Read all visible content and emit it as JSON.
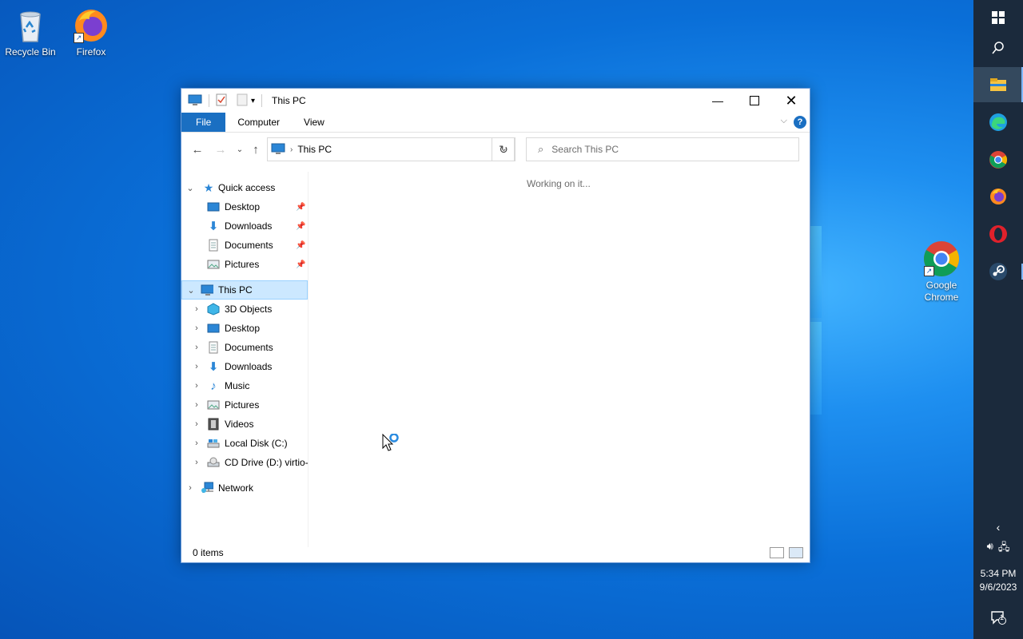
{
  "desktop": {
    "icons": [
      {
        "label": "Recycle Bin",
        "icon": "recycle-bin-icon"
      },
      {
        "label": "Firefox",
        "icon": "firefox-icon"
      },
      {
        "label": "Google Chrome",
        "icon": "chrome-icon"
      }
    ]
  },
  "window": {
    "title": "This PC",
    "ribbon_tabs": [
      "File",
      "Computer",
      "View"
    ],
    "address": {
      "crumb": "This PC"
    },
    "search": {
      "placeholder": "Search This PC"
    },
    "content_message": "Working on it...",
    "status": "0 items",
    "nav": {
      "quick_access": {
        "label": "Quick access",
        "items": [
          {
            "label": "Desktop",
            "pinned": true
          },
          {
            "label": "Downloads",
            "pinned": true
          },
          {
            "label": "Documents",
            "pinned": true
          },
          {
            "label": "Pictures",
            "pinned": true
          }
        ]
      },
      "this_pc": {
        "label": "This PC",
        "items": [
          "3D Objects",
          "Desktop",
          "Documents",
          "Downloads",
          "Music",
          "Pictures",
          "Videos",
          "Local Disk (C:)",
          "CD Drive (D:) virtio-"
        ]
      },
      "network": {
        "label": "Network"
      }
    }
  },
  "taskbar": {
    "time": "5:34 PM",
    "date": "9/6/2023",
    "notifications_count": "1",
    "apps": [
      "start-icon",
      "search-icon",
      "file-explorer-icon",
      "edge-icon",
      "chrome-icon",
      "firefox-icon",
      "opera-icon",
      "steam-icon"
    ]
  },
  "colors": {
    "accent": "#1a6fc2",
    "selection": "#cce8ff",
    "taskbar": "#1b2a3c"
  }
}
